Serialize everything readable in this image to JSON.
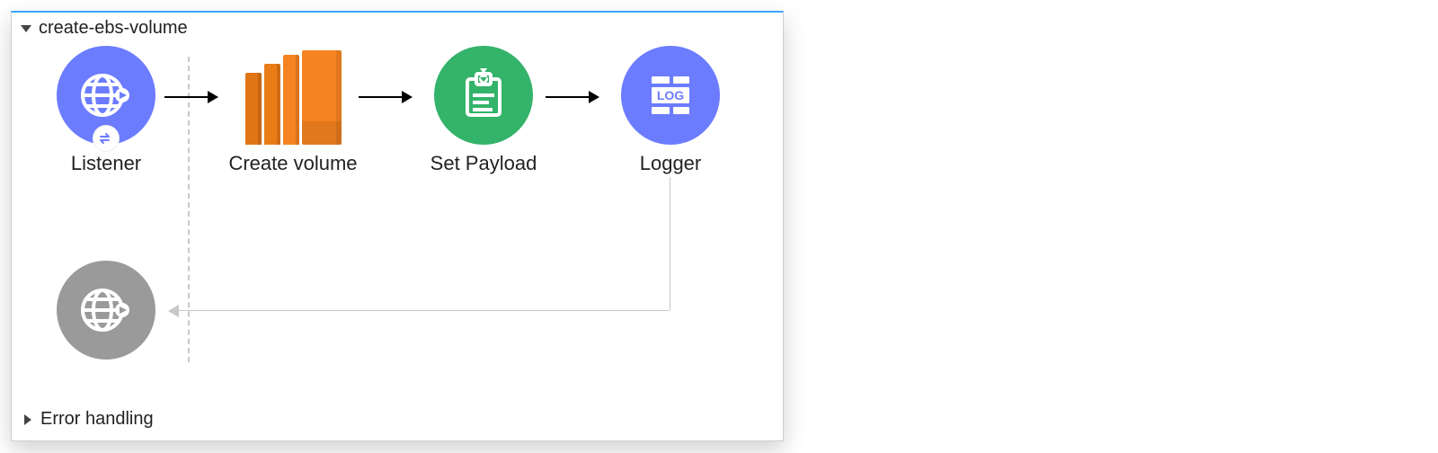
{
  "flow": {
    "title": "create-ebs-volume",
    "nodes": {
      "listener": {
        "label": "Listener"
      },
      "createVolume": {
        "label": "Create volume"
      },
      "setPayload": {
        "label": "Set Payload"
      },
      "logger": {
        "label": "Logger"
      }
    }
  },
  "sections": {
    "errorHandling": {
      "label": "Error handling"
    }
  },
  "icons": {
    "listener": "globe-arrow-icon",
    "listenerBadge": "exchange-icon",
    "createVolume": "aws-volume-icon",
    "setPayload": "clipboard-download-icon",
    "logger": "log-brick-icon",
    "response": "globe-arrow-icon"
  },
  "colors": {
    "listenerBg": "#6c7cff",
    "setPayloadBg": "#34b36a",
    "loggerBg": "#6c7cff",
    "disabledBg": "#9a9a9a",
    "awsOrange": "#f58320",
    "topBorder": "#3aa6ff"
  }
}
